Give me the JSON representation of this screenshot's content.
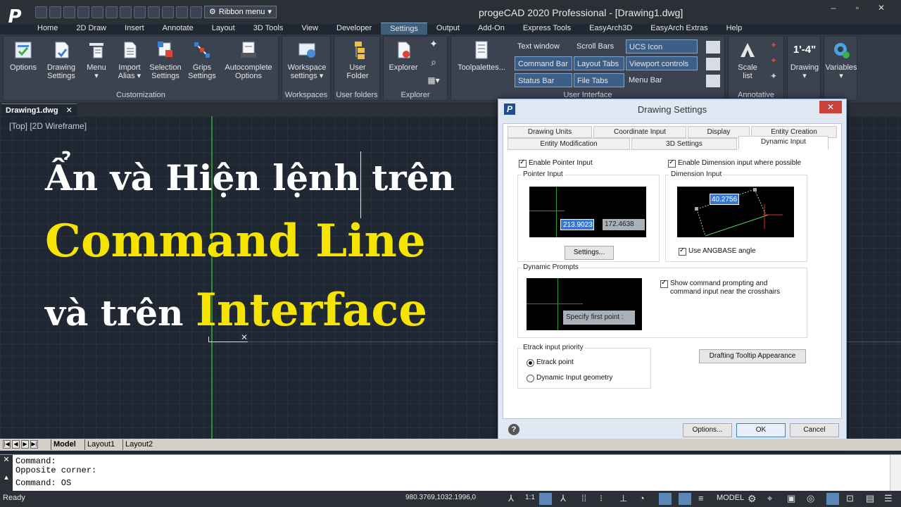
{
  "app": {
    "logo": "P",
    "title": "progeCAD 2020 Professional - [Drawing1.dwg]",
    "qat_dropdown": "Ribbon menu",
    "window_controls": [
      "–",
      "▫",
      "✕"
    ]
  },
  "menu_tabs": [
    "Home",
    "2D Draw",
    "Insert",
    "Annotate",
    "Layout",
    "3D Tools",
    "View",
    "Developer",
    "Settings",
    "Output",
    "Add-On",
    "Express Tools",
    "EasyArch3D",
    "EasyArch Extras",
    "Help"
  ],
  "ribbon": {
    "customization": {
      "title": "Customization",
      "buttons": [
        {
          "label": "Options",
          "icon": "options-icon"
        },
        {
          "label": "Drawing\nSettings",
          "icon": "drawing-settings-icon"
        },
        {
          "label": "Menu\n▾",
          "icon": "menu-icon"
        },
        {
          "label": "Import\nAlias ▾",
          "icon": "import-alias-icon"
        },
        {
          "label": "Selection\nSettings",
          "icon": "selection-settings-icon"
        },
        {
          "label": "Grips\nSettings",
          "icon": "grips-icon"
        },
        {
          "label": "Autocomplete\nOptions",
          "icon": "autocomplete-icon"
        }
      ]
    },
    "workspaces": {
      "title": "Workspaces",
      "button": "Workspace\nsettings ▾"
    },
    "user_folders": {
      "title": "User folders",
      "button": "User\nFolder"
    },
    "explorer": {
      "title": "Explorer",
      "button": "Explorer"
    },
    "user_interface": {
      "title": "User Interface",
      "big_button": "Toolpalettes...",
      "toggles": [
        {
          "label": "Text window",
          "on": false
        },
        {
          "label": "Scroll Bars",
          "on": false
        },
        {
          "label": "UCS Icon",
          "on": true
        },
        {
          "label": "Command Bar",
          "on": true
        },
        {
          "label": "Layout Tabs",
          "on": true
        },
        {
          "label": "Viewport controls",
          "on": true
        },
        {
          "label": "Status Bar",
          "on": true
        },
        {
          "label": "File Tabs",
          "on": true
        },
        {
          "label": "Menu Bar",
          "on": false
        }
      ]
    },
    "annotative": {
      "title": "Annotative",
      "button": "Scale\nlist"
    },
    "drawing": {
      "button": "Drawing\n▾",
      "scale_text": "1'-4\""
    },
    "variables": {
      "button": "Variables\n▾"
    }
  },
  "document": {
    "tab": "Drawing1.dwg",
    "view_label": "[Top] [2D Wireframe]"
  },
  "overlay": {
    "line1": "Ẩn và Hiện lệnh trên",
    "line2": "Command Line",
    "line3a": "và trên ",
    "line3b": "Interface",
    "colors": {
      "white": "#ffffff",
      "yellow": "#f5e400"
    }
  },
  "dialog": {
    "title": "Drawing Settings",
    "tabs_row1": [
      "Drawing Units",
      "Coordinate Input",
      "Display",
      "Entity Creation"
    ],
    "tabs_row2": [
      "Entity Modification",
      "3D Settings",
      "Dynamic Input"
    ],
    "enable_pointer_input": "Enable Pointer Input",
    "enable_dimension_input": "Enable Dimension input where possible",
    "pointer_input_group": "Pointer Input",
    "pointer_x": "213.9023",
    "pointer_y": "172.4638",
    "settings_button": "Settings...",
    "dimension_input_group": "Dimension Input",
    "dimension_value": "40.2756",
    "use_angbase": "Use ANGBASE angle",
    "dynamic_prompts_group": "Dynamic Prompts",
    "prompt_text": "Specify first point :",
    "show_command_prompting": "Show command prompting and\ncommand input near the crosshairs",
    "etrack_group": "Etrack input priority",
    "etrack_point": "Etrack point",
    "dynamic_input_geometry": "Dynamic Input geometry",
    "drafting_tooltip_button": "Drafting Tooltip Appearance",
    "options_button": "Options...",
    "ok_button": "OK",
    "cancel_button": "Cancel"
  },
  "layout_tabs": [
    "Model",
    "Layout1",
    "Layout2"
  ],
  "command_line": {
    "lines": [
      "Command:",
      "Opposite corner:",
      "Command: OS"
    ]
  },
  "status_bar": {
    "ready": "Ready",
    "coords": "980.3769,1032.1996,0",
    "scale": "1:1",
    "model": "MODEL"
  }
}
